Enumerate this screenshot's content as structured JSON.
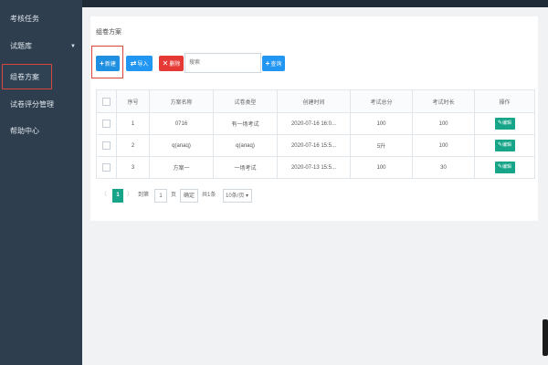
{
  "sidebar": {
    "items": [
      {
        "label": "考核任务"
      },
      {
        "label": "试题库"
      },
      {
        "label": "组卷方案"
      },
      {
        "label": "试卷评分管理"
      },
      {
        "label": "帮助中心"
      }
    ]
  },
  "page": {
    "title": "组卷方案"
  },
  "toolbar": {
    "new_label": "新建",
    "import_label": "导入",
    "delete_label": "删除",
    "search_placeholder": "搜索",
    "search_label": "查询"
  },
  "table": {
    "headers": [
      "",
      "序号",
      "方案名称",
      "试卷类型",
      "创建时间",
      "考试总分",
      "考试时长",
      "操作"
    ],
    "rows": [
      {
        "index": "1",
        "name": "0716",
        "type": "有一场考试",
        "created": "2020-07-16 16:0...",
        "score": "100",
        "duration": "100",
        "action": "编辑"
      },
      {
        "index": "2",
        "name": "q(anaq)",
        "type": "q(anaq)",
        "created": "2020-07-16 15:5...",
        "score": "5升",
        "duration": "100",
        "action": "编辑"
      },
      {
        "index": "3",
        "name": "方案一",
        "type": "一场考试",
        "created": "2020-07-13 15:5...",
        "score": "100",
        "duration": "30",
        "action": "编辑"
      }
    ]
  },
  "pagination": {
    "prev": "〈",
    "current": "1",
    "next": "〉",
    "goto_label": "到第",
    "page_input": "1",
    "page_unit": "页",
    "confirm": "确定",
    "total": "共1条",
    "page_size": "10条/页"
  },
  "colors": {
    "sidebar_bg": "#2e3e4e",
    "primary": "#2196f3",
    "danger": "#e53935",
    "success": "#17a589",
    "highlight": "#d9463b"
  }
}
